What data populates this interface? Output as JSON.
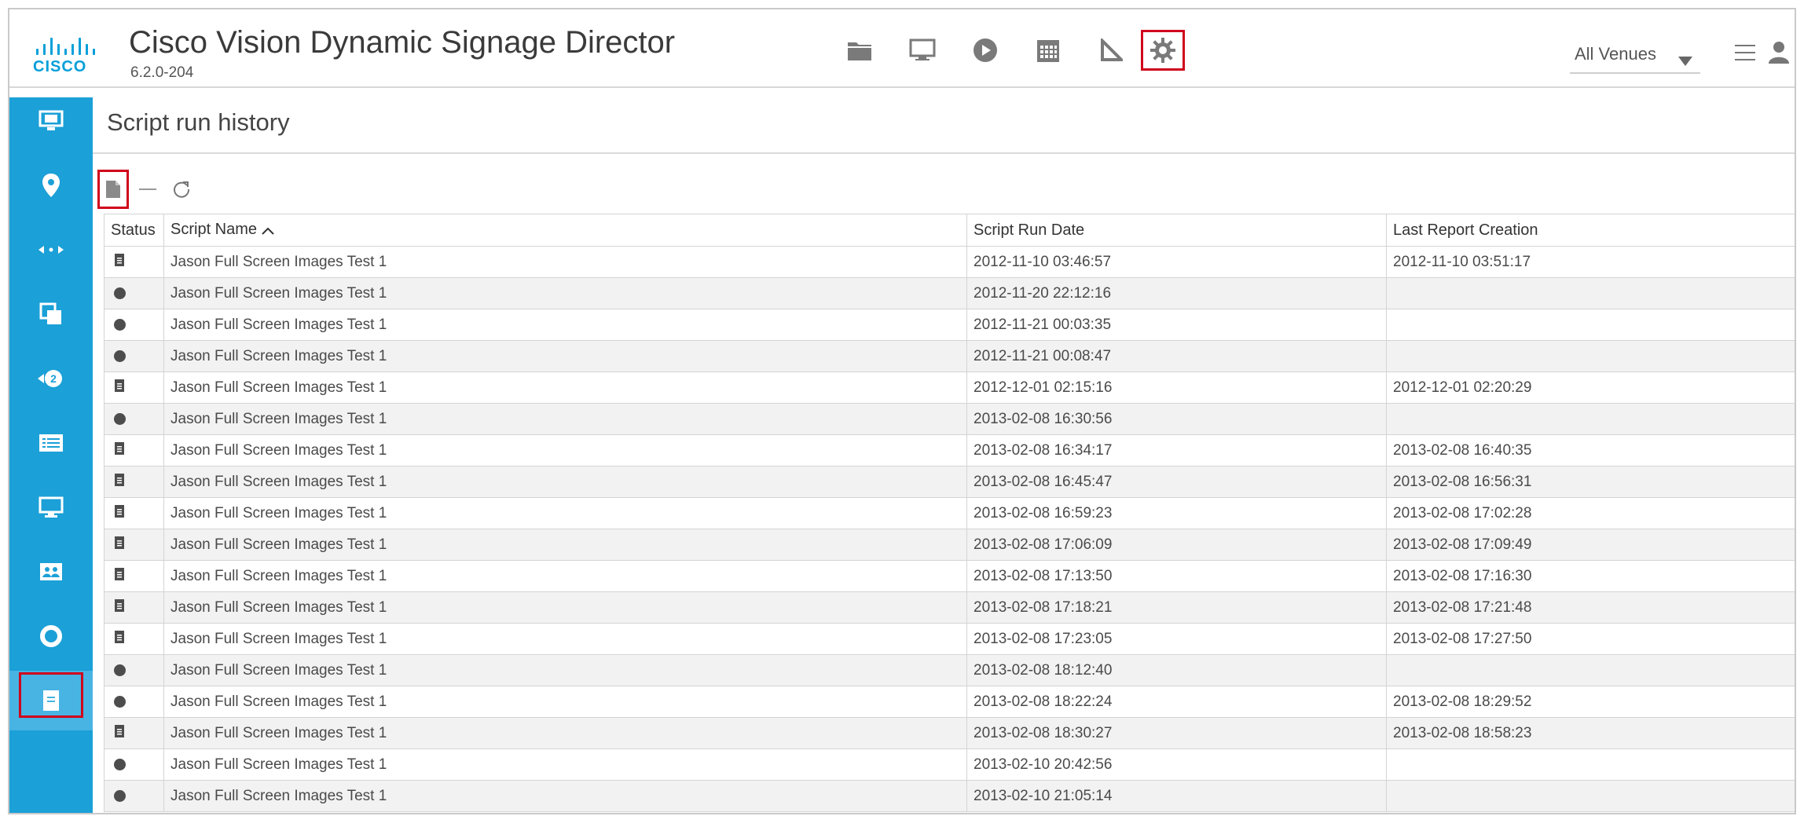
{
  "header": {
    "app_title": "Cisco Vision Dynamic Signage Director",
    "version": "6.2.0-204",
    "logo_text": "CISCO",
    "venue_select": "All Venues",
    "nav_icons": [
      "folder-icon",
      "monitor-icon",
      "play-icon",
      "calendar-icon",
      "triangle-ruler-icon",
      "gear-icon"
    ],
    "selected_nav": "gear-icon"
  },
  "sidebar": {
    "items": [
      "display-setup-icon",
      "location-pin-icon",
      "connection-icon",
      "layers-icon",
      "sync-icon",
      "list-icon",
      "screen-icon",
      "image-icon",
      "circle-icon",
      "script-report-icon"
    ],
    "selected": "script-report-icon"
  },
  "page": {
    "title": "Script run history"
  },
  "table": {
    "headers": {
      "status": "Status",
      "script_name": "Script Name",
      "run_date": "Script Run Date",
      "report": "Last Report Creation"
    },
    "rows": [
      {
        "status": "report",
        "name": "Jason Full Screen Images Test 1",
        "run": "2012-11-10 03:46:57",
        "report": "2012-11-10 03:51:17"
      },
      {
        "status": "none",
        "name": "Jason Full Screen Images Test 1",
        "run": "2012-11-20 22:12:16",
        "report": ""
      },
      {
        "status": "none",
        "name": "Jason Full Screen Images Test 1",
        "run": "2012-11-21 00:03:35",
        "report": ""
      },
      {
        "status": "none",
        "name": "Jason Full Screen Images Test 1",
        "run": "2012-11-21 00:08:47",
        "report": ""
      },
      {
        "status": "report",
        "name": "Jason Full Screen Images Test 1",
        "run": "2012-12-01 02:15:16",
        "report": "2012-12-01 02:20:29"
      },
      {
        "status": "none",
        "name": "Jason Full Screen Images Test 1",
        "run": "2013-02-08 16:30:56",
        "report": ""
      },
      {
        "status": "report",
        "name": "Jason Full Screen Images Test 1",
        "run": "2013-02-08 16:34:17",
        "report": "2013-02-08 16:40:35"
      },
      {
        "status": "report",
        "name": "Jason Full Screen Images Test 1",
        "run": "2013-02-08 16:45:47",
        "report": "2013-02-08 16:56:31"
      },
      {
        "status": "report",
        "name": "Jason Full Screen Images Test 1",
        "run": "2013-02-08 16:59:23",
        "report": "2013-02-08 17:02:28"
      },
      {
        "status": "report",
        "name": "Jason Full Screen Images Test 1",
        "run": "2013-02-08 17:06:09",
        "report": "2013-02-08 17:09:49"
      },
      {
        "status": "report",
        "name": "Jason Full Screen Images Test 1",
        "run": "2013-02-08 17:13:50",
        "report": "2013-02-08 17:16:30"
      },
      {
        "status": "report",
        "name": "Jason Full Screen Images Test 1",
        "run": "2013-02-08 17:18:21",
        "report": "2013-02-08 17:21:48"
      },
      {
        "status": "report",
        "name": "Jason Full Screen Images Test 1",
        "run": "2013-02-08 17:23:05",
        "report": "2013-02-08 17:27:50"
      },
      {
        "status": "none",
        "name": "Jason Full Screen Images Test 1",
        "run": "2013-02-08 18:12:40",
        "report": ""
      },
      {
        "status": "none",
        "name": "Jason Full Screen Images Test 1",
        "run": "2013-02-08 18:22:24",
        "report": "2013-02-08 18:29:52"
      },
      {
        "status": "report",
        "name": "Jason Full Screen Images Test 1",
        "run": "2013-02-08 18:30:27",
        "report": "2013-02-08 18:58:23"
      },
      {
        "status": "none",
        "name": "Jason Full Screen Images Test 1",
        "run": "2013-02-10 20:42:56",
        "report": ""
      },
      {
        "status": "none",
        "name": "Jason Full Screen Images Test 1",
        "run": "2013-02-10 21:05:14",
        "report": ""
      }
    ]
  },
  "colors": {
    "brand_blue": "#049fd9",
    "sidebar_blue": "#1ba0d7",
    "highlight_red": "#d0021b"
  }
}
